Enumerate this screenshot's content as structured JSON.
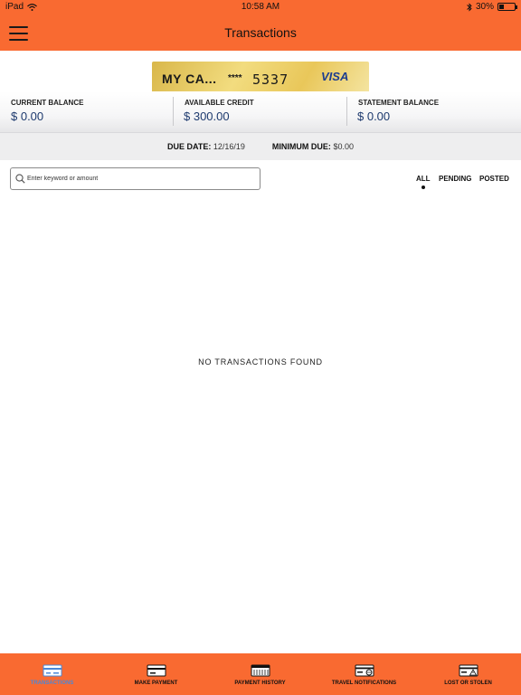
{
  "status_bar": {
    "device": "iPad",
    "time": "10:58 AM",
    "battery": "30%",
    "battery_level": 0.3
  },
  "header": {
    "title": "Transactions"
  },
  "card": {
    "name": "MY CA...",
    "mask": "****",
    "last4": "5337",
    "brand": "VISA"
  },
  "balances": [
    {
      "label": "CURRENT BALANCE",
      "value": "$ 0.00"
    },
    {
      "label": "AVAILABLE CREDIT",
      "value": "$ 300.00"
    },
    {
      "label": "STATEMENT BALANCE",
      "value": "$ 0.00"
    }
  ],
  "due": {
    "due_label": "DUE DATE:",
    "due_value": "12/16/19",
    "min_label": "MINIMUM DUE:",
    "min_value": "$0.00"
  },
  "search": {
    "placeholder": "Enter keyword or amount",
    "value": ""
  },
  "filters": [
    "ALL",
    "PENDING",
    "POSTED"
  ],
  "empty_message": "NO TRANSACTIONS FOUND",
  "tabs": [
    {
      "label": "TRANSACTIONS",
      "icon": "card-icon"
    },
    {
      "label": "MAKE PAYMENT",
      "icon": "payment-card-icon"
    },
    {
      "label": "PAYMENT HISTORY",
      "icon": "calendar-icon"
    },
    {
      "label": "TRAVEL NOTIFICATIONS",
      "icon": "travel-card-icon"
    },
    {
      "label": "LOST OR STOLEN",
      "icon": "alert-card-icon"
    }
  ],
  "colors": {
    "header": "#f96a31",
    "active_tab": "#4a88d8",
    "balance_value": "#1d3a6e"
  }
}
